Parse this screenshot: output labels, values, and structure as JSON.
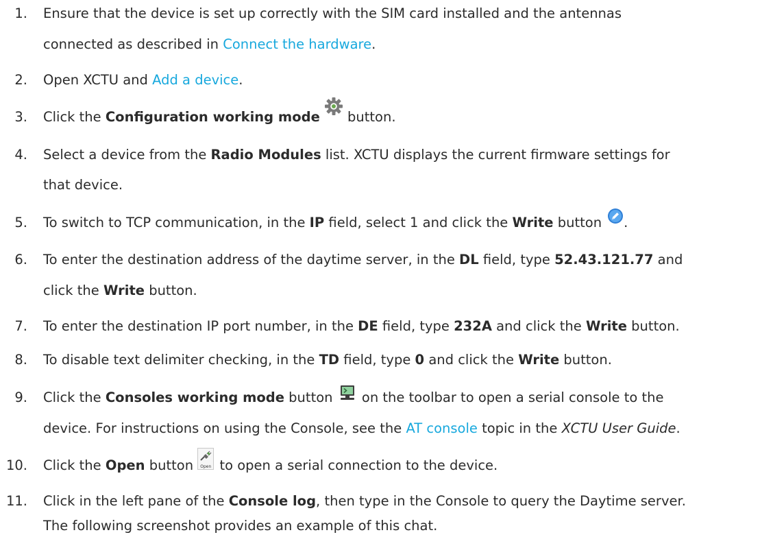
{
  "colors": {
    "text": "#2b2b2b",
    "link": "#17a8dd"
  },
  "steps": [
    {
      "number": "1.",
      "line1": {
        "a": "Ensure that the device is set up correctly with the SIM card installed and the antennas"
      },
      "line2": {
        "a": "connected as described in ",
        "link": "Connect the hardware",
        "b": "."
      }
    },
    {
      "number": "2.",
      "a": "Open XCTU and ",
      "link": "Add a device",
      "b": "."
    },
    {
      "number": "3.",
      "a": "Click the ",
      "bold": "Configuration working mode",
      "icon": "gear-icon",
      "b": " button."
    },
    {
      "number": "4.",
      "line1": {
        "a": "Select a device from the ",
        "bold": "Radio Modules",
        "b": " list. XCTU displays the current firmware settings for"
      },
      "line2": {
        "a": "that device."
      }
    },
    {
      "number": "5.",
      "a": "To switch to TCP communication, in the ",
      "bold1": "IP",
      "b": " field, select 1 and click the ",
      "bold2": "Write",
      "c": " button",
      "icon": "write-pencil-icon",
      "d": "."
    },
    {
      "number": "6.",
      "line1": {
        "a": "To enter the destination address of the daytime server, in the ",
        "bold1": "DL",
        "b": " field, type ",
        "bold2": "52.43.121.77",
        "c": " and"
      },
      "line2": {
        "a": "click the ",
        "bold": "Write",
        "b": " button."
      }
    },
    {
      "number": "7.",
      "a": "To enter the destination IP port number, in the ",
      "bold1": "DE",
      "b": " field, type ",
      "bold2": "232A",
      "c": " and click the ",
      "bold3": "Write",
      "d": " button."
    },
    {
      "number": "8.",
      "a": "To disable text delimiter checking, in the ",
      "bold1": "TD",
      "b": " field, type ",
      "bold2": "0",
      "c": " and click the ",
      "bold3": "Write",
      "d": " button."
    },
    {
      "number": "9.",
      "line1": {
        "a": "Click the ",
        "bold": "Consoles working mode",
        "b": " button ",
        "icon": "console-monitor-icon",
        "c": " on the toolbar to open a serial console to the"
      },
      "line2": {
        "a": "device. For instructions on using the Console, see the ",
        "link": "AT console",
        "b": " topic in the ",
        "italic": "XCTU User Guide",
        "c": "."
      }
    },
    {
      "number": "10.",
      "a": "Click the ",
      "bold": "Open",
      "b": " button ",
      "icon": "open-connection-icon",
      "icon_label": "Open",
      "c": " to open a serial connection to the device."
    },
    {
      "number": "11.",
      "line1": {
        "a": "Click in the left pane of the ",
        "bold": "Console log",
        "b": ", then type in the Console to query the Daytime server."
      },
      "line2": {
        "a": "The following screenshot provides an example of this chat."
      }
    }
  ]
}
